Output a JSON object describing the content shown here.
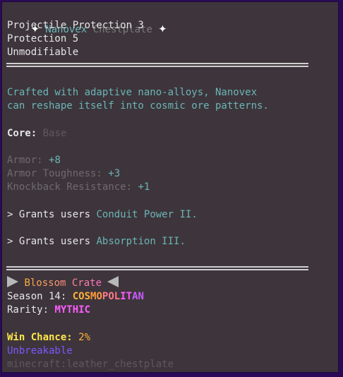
{
  "title": {
    "star_left": "✦",
    "name": "Nanovex",
    "chest": "Chestplate",
    "star_right": "✦"
  },
  "enchants": [
    "Projectile Protection 3",
    "Protection 5",
    "Unmodifiable"
  ],
  "lore": [
    "Crafted with adaptive nano-alloys, Nanovex",
    "can reshape itself into cosmic ore patterns."
  ],
  "core": {
    "label": "Core:",
    "value": "Base"
  },
  "stats": [
    {
      "label": "Armor:",
      "value": "+8"
    },
    {
      "label": "Armor Toughness:",
      "value": "+3"
    },
    {
      "label": "Knockback Resistance:",
      "value": "+1"
    }
  ],
  "abilities": [
    {
      "bullet": ">",
      "prefix": "Grants users",
      "power": "Conduit Power II."
    },
    {
      "bullet": ">",
      "prefix": "Grants users",
      "power": "Absorption III."
    }
  ],
  "crate": {
    "name": "Blossom Crate"
  },
  "season": {
    "label": "Season 14:",
    "value": "COSMOPOLITAN",
    "colors": [
      "#ffb03a",
      "#ff9a3a",
      "#ff7a8a",
      "#ff5cff",
      "#c85cff"
    ]
  },
  "rarity": {
    "label": "Rarity:",
    "value": "MYTHIC"
  },
  "win_chance": {
    "label": "Win Chance:",
    "value": "2%"
  },
  "unbreakable": "Unbreakable",
  "item_id": "minecraft:leather_chestplate"
}
